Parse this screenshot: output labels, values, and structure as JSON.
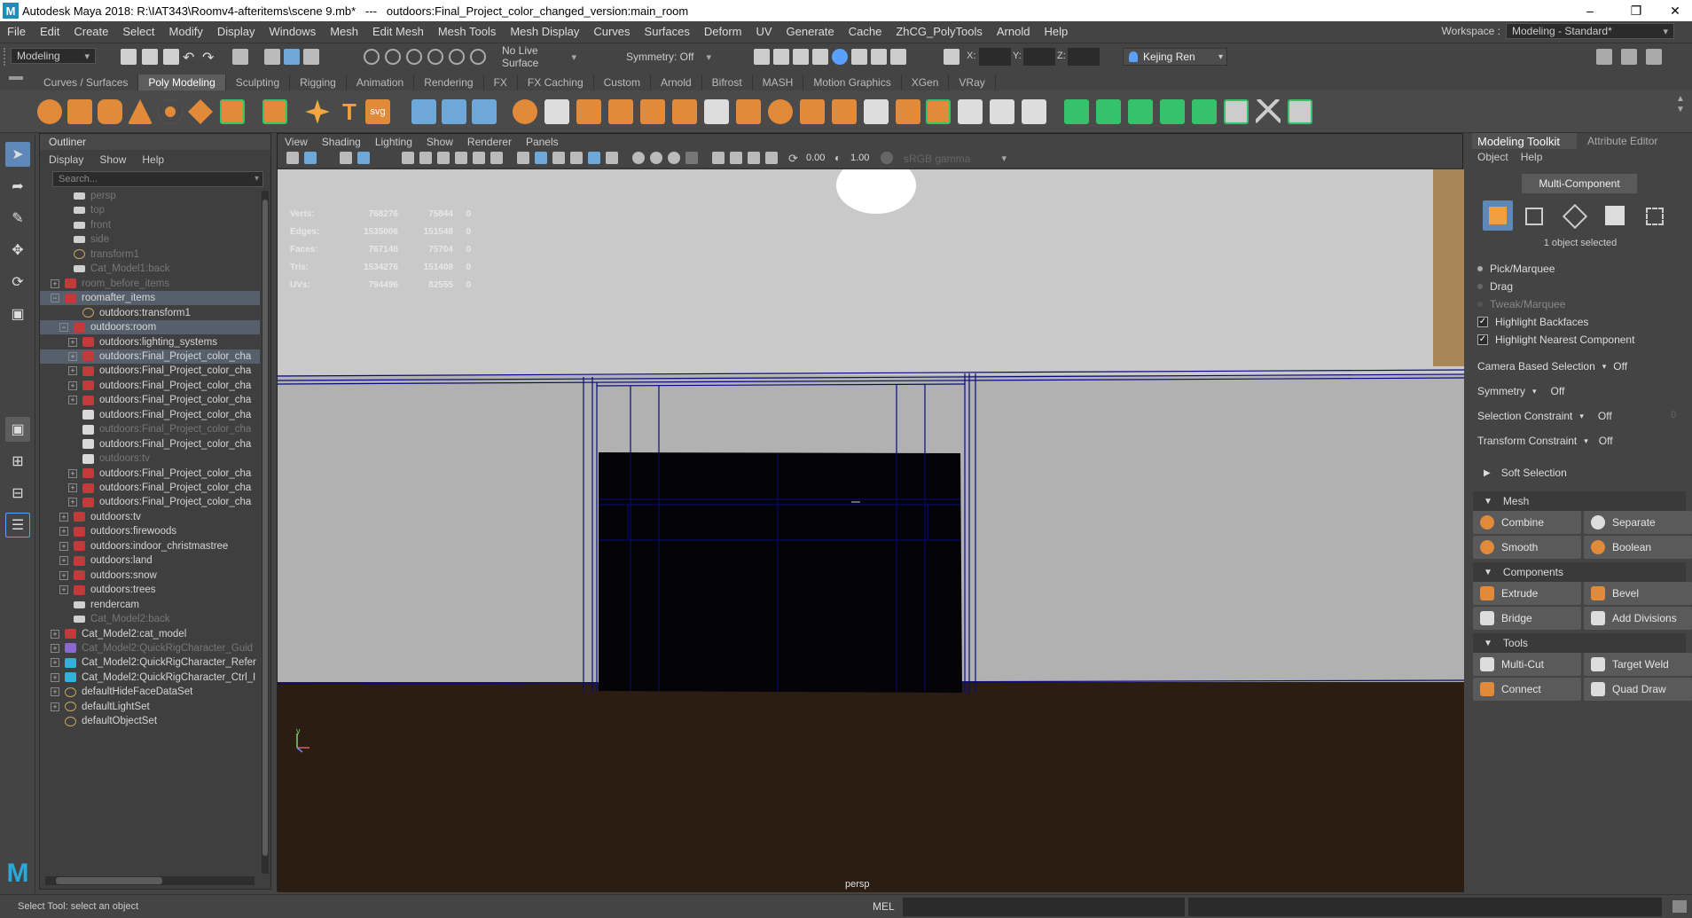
{
  "window": {
    "title": "Autodesk Maya 2018: R:\\IAT343\\Roomv4-afteritems\\scene 9.mb*   ---   outdoors:Final_Project_color_changed_version:main_room",
    "logo": "M"
  },
  "menubar": {
    "items": [
      "File",
      "Edit",
      "Create",
      "Select",
      "Modify",
      "Display",
      "Windows",
      "Mesh",
      "Edit Mesh",
      "Mesh Tools",
      "Mesh Display",
      "Curves",
      "Surfaces",
      "Deform",
      "UV",
      "Generate",
      "Cache",
      "ZhCG_PolyTools",
      "Arnold",
      "Help"
    ],
    "workspace_label": "Workspace :",
    "workspace_value": "Modeling - Standard*"
  },
  "statusline": {
    "mode": "Modeling",
    "live_surface": "No Live Surface",
    "symmetry": "Symmetry: Off",
    "x_label": "X:",
    "y_label": "Y:",
    "z_label": "Z:",
    "user": "Kejing Ren"
  },
  "shelf": {
    "tabs": [
      "Curves / Surfaces",
      "Poly Modeling",
      "Sculpting",
      "Rigging",
      "Animation",
      "Rendering",
      "FX",
      "FX Caching",
      "Custom",
      "Arnold",
      "Bifrost",
      "MASH",
      "Motion Graphics",
      "XGen",
      "VRay"
    ],
    "selected": "Poly Modeling",
    "svg_label": "svg",
    "text_tool": "T"
  },
  "outliner": {
    "title": "Outliner",
    "menu": [
      "Display",
      "Show",
      "Help"
    ],
    "search_placeholder": "Search...",
    "rows": [
      {
        "label": "persp",
        "icon": "camera-icon",
        "exp": "",
        "dim": true,
        "indent": 1
      },
      {
        "label": "top",
        "icon": "camera-icon",
        "exp": "",
        "dim": true,
        "indent": 1
      },
      {
        "label": "front",
        "icon": "camera-icon",
        "exp": "",
        "dim": true,
        "indent": 1
      },
      {
        "label": "side",
        "icon": "camera-icon",
        "exp": "",
        "dim": true,
        "indent": 1
      },
      {
        "label": "transform1",
        "icon": "transform-icon",
        "exp": "",
        "dim": true,
        "indent": 1
      },
      {
        "label": "Cat_Model1:back",
        "icon": "camera-icon",
        "exp": "",
        "dim": true,
        "indent": 1
      },
      {
        "label": "room_before_items",
        "icon": "group-icon",
        "exp": "+",
        "dim": true,
        "indent": 0
      },
      {
        "label": "roomafter_items",
        "icon": "group-icon",
        "exp": "−",
        "dim": false,
        "indent": 0,
        "hl": true
      },
      {
        "label": "outdoors:transform1",
        "icon": "transform-icon",
        "exp": "",
        "dim": false,
        "indent": 2
      },
      {
        "label": "outdoors:room",
        "icon": "group-icon",
        "exp": "−",
        "dim": false,
        "indent": 1,
        "hl": true
      },
      {
        "label": "outdoors:lighting_systems",
        "icon": "group-icon",
        "exp": "+",
        "dim": false,
        "indent": 2
      },
      {
        "label": "outdoors:Final_Project_color_cha",
        "icon": "group-icon",
        "exp": "+",
        "dim": false,
        "indent": 2,
        "hl": true
      },
      {
        "label": "outdoors:Final_Project_color_cha",
        "icon": "group-icon",
        "exp": "+",
        "dim": false,
        "indent": 2
      },
      {
        "label": "outdoors:Final_Project_color_cha",
        "icon": "group-icon",
        "exp": "+",
        "dim": false,
        "indent": 2
      },
      {
        "label": "outdoors:Final_Project_color_cha",
        "icon": "group-icon",
        "exp": "+",
        "dim": false,
        "indent": 2
      },
      {
        "label": "outdoors:Final_Project_color_cha",
        "icon": "mesh-icon",
        "exp": "",
        "dim": false,
        "indent": 2
      },
      {
        "label": "outdoors:Final_Project_color_cha",
        "icon": "mesh-icon",
        "exp": "",
        "dim": true,
        "indent": 2
      },
      {
        "label": "outdoors:Final_Project_color_cha",
        "icon": "mesh-icon",
        "exp": "",
        "dim": false,
        "indent": 2
      },
      {
        "label": "outdoors:tv",
        "icon": "mesh-icon",
        "exp": "",
        "dim": true,
        "indent": 2
      },
      {
        "label": "outdoors:Final_Project_color_cha",
        "icon": "group-icon",
        "exp": "+",
        "dim": false,
        "indent": 2
      },
      {
        "label": "outdoors:Final_Project_color_cha",
        "icon": "group-icon",
        "exp": "+",
        "dim": false,
        "indent": 2
      },
      {
        "label": "outdoors:Final_Project_color_cha",
        "icon": "group-icon",
        "exp": "+",
        "dim": false,
        "indent": 2
      },
      {
        "label": "outdoors:tv",
        "icon": "group-icon",
        "exp": "+",
        "dim": false,
        "indent": 1
      },
      {
        "label": "outdoors:firewoods",
        "icon": "group-icon",
        "exp": "+",
        "dim": false,
        "indent": 1
      },
      {
        "label": "outdoors:indoor_christmastree",
        "icon": "group-icon",
        "exp": "+",
        "dim": false,
        "indent": 1
      },
      {
        "label": "outdoors:land",
        "icon": "group-icon",
        "exp": "+",
        "dim": false,
        "indent": 1
      },
      {
        "label": "outdoors:snow",
        "icon": "group-icon",
        "exp": "+",
        "dim": false,
        "indent": 1
      },
      {
        "label": "outdoors:trees",
        "icon": "group-icon",
        "exp": "+",
        "dim": false,
        "indent": 1
      },
      {
        "label": "rendercam",
        "icon": "camera-icon",
        "exp": "",
        "dim": false,
        "indent": 1
      },
      {
        "label": "Cat_Model2:back",
        "icon": "camera-icon",
        "exp": "",
        "dim": true,
        "indent": 1
      },
      {
        "label": "Cat_Model2:cat_model",
        "icon": "group-icon",
        "exp": "+",
        "dim": false,
        "indent": 0
      },
      {
        "label": "Cat_Model2:QuickRigCharacter_Guid",
        "icon": "rig-icon",
        "exp": "+",
        "dim": true,
        "indent": 0
      },
      {
        "label": "Cat_Model2:QuickRigCharacter_Refer",
        "icon": "joint-icon",
        "exp": "+",
        "dim": false,
        "indent": 0
      },
      {
        "label": "Cat_Model2:QuickRigCharacter_Ctrl_I",
        "icon": "joint-icon",
        "exp": "+",
        "dim": false,
        "indent": 0
      },
      {
        "label": "defaultHideFaceDataSet",
        "icon": "set-icon",
        "exp": "+",
        "dim": false,
        "indent": 0
      },
      {
        "label": "defaultLightSet",
        "icon": "set-icon",
        "exp": "+",
        "dim": false,
        "indent": 0
      },
      {
        "label": "defaultObjectSet",
        "icon": "set-icon",
        "exp": "",
        "dim": false,
        "indent": 0
      }
    ]
  },
  "viewport": {
    "menu": [
      "View",
      "Shading",
      "Lighting",
      "Show",
      "Renderer",
      "Panels"
    ],
    "near_clip": "0.00",
    "far_clip": "1.00",
    "color_space": "sRGB gamma",
    "camera": "persp",
    "hud": [
      {
        "label": "Verts:",
        "a": "768276",
        "b": "75844",
        "c": "0"
      },
      {
        "label": "Edges:",
        "a": "1535006",
        "b": "151548",
        "c": "0"
      },
      {
        "label": "Faces:",
        "a": "767148",
        "b": "75704",
        "c": "0"
      },
      {
        "label": "Tris:",
        "a": "1534276",
        "b": "151408",
        "c": "0"
      },
      {
        "label": "UVs:",
        "a": "794496",
        "b": "82555",
        "c": "0"
      }
    ],
    "axis_y": "y",
    "colors": {
      "wall": "#b1b1b1",
      "ceiling": "#c9c9c9",
      "floor": "#2b1d12",
      "wire": "#0a0a7a",
      "tv": "#030308",
      "wood": "#a88657"
    }
  },
  "right_panel": {
    "tabs": [
      "Modeling Toolkit",
      "Attribute Editor"
    ],
    "menu": [
      "Object",
      "Help"
    ],
    "multi_component": "Multi-Component",
    "selected_text": "1 object selected",
    "pick": "Pick/Marquee",
    "drag": "Drag",
    "tweak": "Tweak/Marquee",
    "highlight_backfaces": "Highlight Backfaces",
    "highlight_nearest": "Highlight Nearest Component",
    "camera_based": "Camera Based Selection",
    "camera_based_val": "Off",
    "symmetry": "Symmetry",
    "symmetry_val": "Off",
    "sel_constraint": "Selection Constraint",
    "sel_constraint_val": "Off",
    "sel_constraint_num": "0",
    "transform_constraint": "Transform Constraint",
    "transform_constraint_val": "Off",
    "soft_selection": "Soft Selection",
    "mesh": "Mesh",
    "combine": "Combine",
    "separate": "Separate",
    "smooth": "Smooth",
    "boolean": "Boolean",
    "components": "Components",
    "extrude": "Extrude",
    "bevel": "Bevel",
    "bridge": "Bridge",
    "add_divisions": "Add Divisions",
    "tools": "Tools",
    "multicut": "Multi-Cut",
    "target_weld": "Target Weld",
    "connect": "Connect",
    "quad_draw": "Quad Draw"
  },
  "bottom": {
    "help": "Select Tool: select an object",
    "mel": "MEL"
  }
}
